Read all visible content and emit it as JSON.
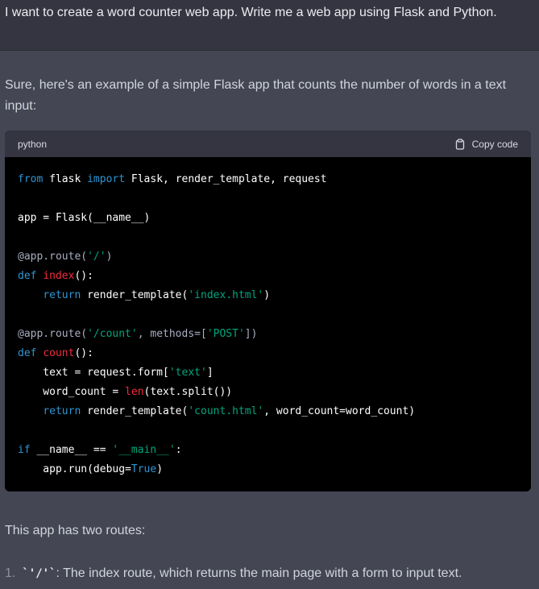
{
  "user_message": "I want to create a word counter web app. Write me a web app using Flask and Python.",
  "assistant": {
    "intro": "Sure, here's an example of a simple Flask app that counts the number of words in a text input:",
    "code_block": {
      "language": "python",
      "copy_label": "Copy code",
      "lines": [
        [
          [
            "kw",
            "from"
          ],
          [
            "t",
            " flask "
          ],
          [
            "kw",
            "import"
          ],
          [
            "t",
            " Flask, render_template, request"
          ]
        ],
        [],
        [
          [
            "t",
            "app = Flask(__name__)"
          ]
        ],
        [],
        [
          [
            "deco",
            "@app.route("
          ],
          [
            "str",
            "'/'"
          ],
          [
            "deco",
            ")"
          ]
        ],
        [
          [
            "kw",
            "def"
          ],
          [
            "t",
            " "
          ],
          [
            "fn",
            "index"
          ],
          [
            "t",
            "():"
          ]
        ],
        [
          [
            "t",
            "    "
          ],
          [
            "kw",
            "return"
          ],
          [
            "t",
            " render_template("
          ],
          [
            "str",
            "'index.html'"
          ],
          [
            "t",
            ")"
          ]
        ],
        [],
        [
          [
            "deco",
            "@app.route("
          ],
          [
            "str",
            "'/count'"
          ],
          [
            "deco",
            ", methods=["
          ],
          [
            "str",
            "'POST'"
          ],
          [
            "deco",
            "])"
          ]
        ],
        [
          [
            "kw",
            "def"
          ],
          [
            "t",
            " "
          ],
          [
            "fn",
            "count"
          ],
          [
            "t",
            "():"
          ]
        ],
        [
          [
            "t",
            "    text = request.form["
          ],
          [
            "str",
            "'text'"
          ],
          [
            "t",
            "]"
          ]
        ],
        [
          [
            "t",
            "    word_count = "
          ],
          [
            "fn",
            "len"
          ],
          [
            "t",
            "(text.split())"
          ]
        ],
        [
          [
            "t",
            "    "
          ],
          [
            "kw",
            "return"
          ],
          [
            "t",
            " render_template("
          ],
          [
            "str",
            "'count.html'"
          ],
          [
            "t",
            ", word_count=word_count)"
          ]
        ],
        [],
        [
          [
            "kw",
            "if"
          ],
          [
            "t",
            " __name__ == "
          ],
          [
            "str",
            "'__main__'"
          ],
          [
            "t",
            ":"
          ]
        ],
        [
          [
            "t",
            "    app.run(debug="
          ],
          [
            "kw",
            "True"
          ],
          [
            "t",
            ")"
          ]
        ]
      ]
    },
    "after_text": "This app has two routes:",
    "list": [
      {
        "number": "1.",
        "code": "`'/'`",
        "text": ": The index route, which returns the main page with a form to input text."
      }
    ]
  }
}
